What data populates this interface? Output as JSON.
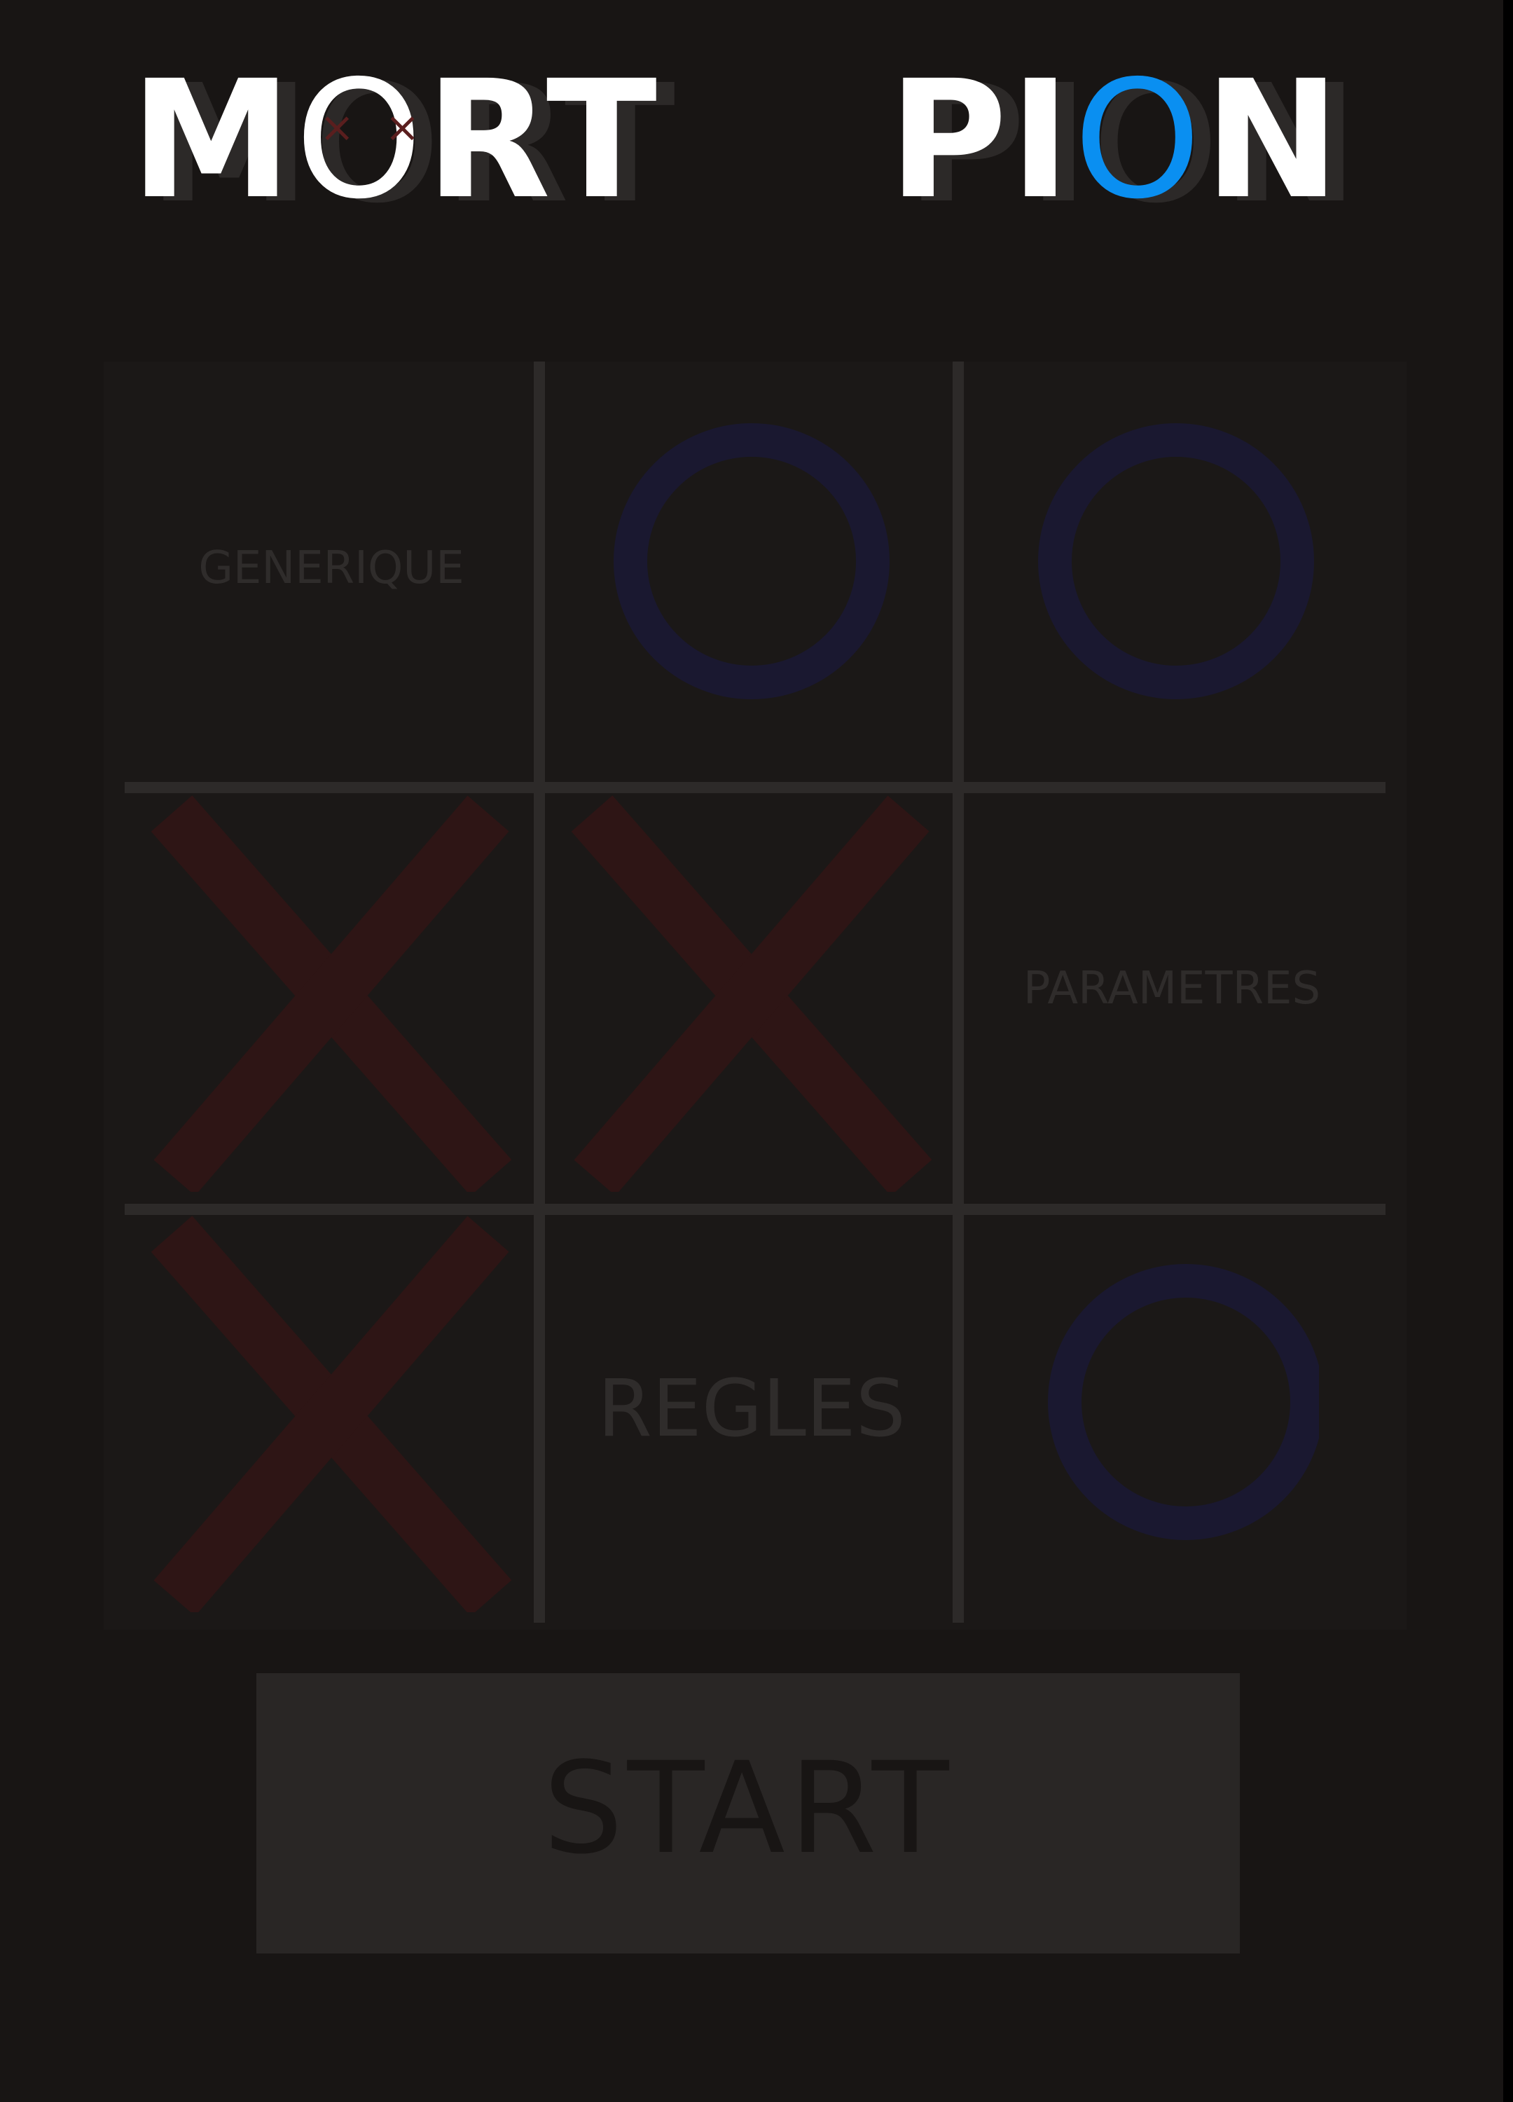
{
  "title": {
    "left_word": "MORT",
    "right_word": "PION",
    "left_ring_letter_color": "#ffffff",
    "right_ring_letter_color": "#0a8ff1",
    "eyes_glyph": "× ×"
  },
  "board": {
    "cells": [
      {
        "mark": "label",
        "text": "GENERIQUE"
      },
      {
        "mark": "O"
      },
      {
        "mark": "O"
      },
      {
        "mark": "X"
      },
      {
        "mark": "X"
      },
      {
        "mark": "label",
        "text": "PARAMETRES"
      },
      {
        "mark": "X"
      },
      {
        "mark": "label",
        "text": "REGLES"
      },
      {
        "mark": "O"
      }
    ],
    "x_color": "#2e1515",
    "o_color": "#1a1830"
  },
  "start_button": {
    "label": "START"
  },
  "colors": {
    "background": "#181514",
    "accent_blue": "#0a8ff1"
  }
}
